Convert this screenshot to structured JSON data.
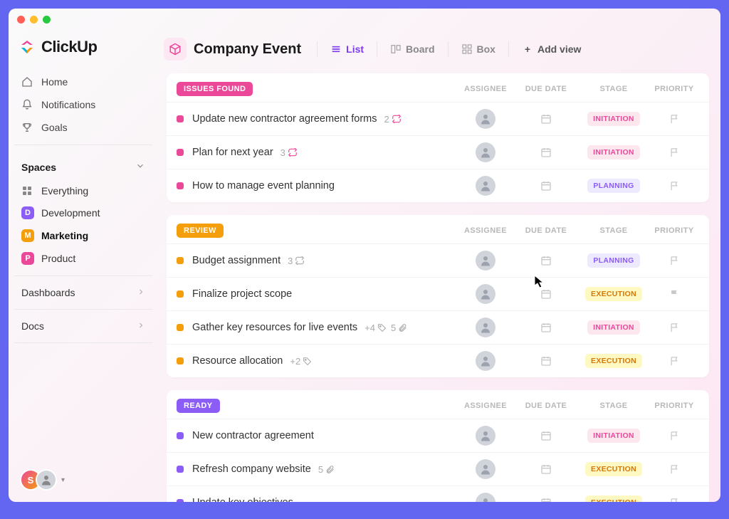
{
  "brand": "ClickUp",
  "nav": {
    "home": "Home",
    "notifications": "Notifications",
    "goals": "Goals"
  },
  "spaces": {
    "header": "Spaces",
    "everything": "Everything",
    "items": [
      {
        "letter": "D",
        "label": "Development",
        "color": "#8b5cf6"
      },
      {
        "letter": "M",
        "label": "Marketing",
        "color": "#f59e0b",
        "active": true
      },
      {
        "letter": "P",
        "label": "Product",
        "color": "#ec4899"
      }
    ]
  },
  "sidebar_bottom": {
    "dashboards": "Dashboards",
    "docs": "Docs"
  },
  "user_initial": "S",
  "page": {
    "title": "Company Event",
    "views": {
      "list": "List",
      "board": "Board",
      "box": "Box",
      "add": "Add view"
    }
  },
  "columns": {
    "assignee": "ASSIGNEE",
    "due": "DUE DATE",
    "stage": "STAGE",
    "priority": "PRIORITY"
  },
  "groups": [
    {
      "name": "ISSUES FOUND",
      "color": "#ec4899",
      "sq": "#ec4899",
      "tasks": [
        {
          "title": "Update new contractor agreement forms",
          "subtasks": 2,
          "stage": "INITIATION",
          "stageClass": "stage-initiation"
        },
        {
          "title": "Plan for next year",
          "subtasks": 3,
          "stage": "INITIATION",
          "stageClass": "stage-initiation"
        },
        {
          "title": "How to manage event planning",
          "stage": "PLANNING",
          "stageClass": "stage-planning"
        }
      ]
    },
    {
      "name": "REVIEW",
      "color": "#f59e0b",
      "sq": "#f59e0b",
      "tasks": [
        {
          "title": "Budget assignment",
          "recur": 3,
          "stage": "PLANNING",
          "stageClass": "stage-planning"
        },
        {
          "title": "Finalize project scope",
          "stage": "EXECUTION",
          "stageClass": "stage-execution",
          "priorityRed": true
        },
        {
          "title": "Gather key resources for live events",
          "tags": "+4",
          "attach": 5,
          "stage": "INITIATION",
          "stageClass": "stage-initiation"
        },
        {
          "title": "Resource allocation",
          "tags": "+2",
          "stage": "EXECUTION",
          "stageClass": "stage-execution"
        }
      ]
    },
    {
      "name": "READY",
      "color": "#8b5cf6",
      "sq": "#8b5cf6",
      "tasks": [
        {
          "title": "New contractor agreement",
          "stage": "INITIATION",
          "stageClass": "stage-initiation"
        },
        {
          "title": "Refresh company website",
          "attach": 5,
          "stage": "EXECUTION",
          "stageClass": "stage-execution"
        },
        {
          "title": "Update key objectives",
          "stage": "EXECUTION",
          "stageClass": "stage-execution"
        }
      ]
    }
  ]
}
